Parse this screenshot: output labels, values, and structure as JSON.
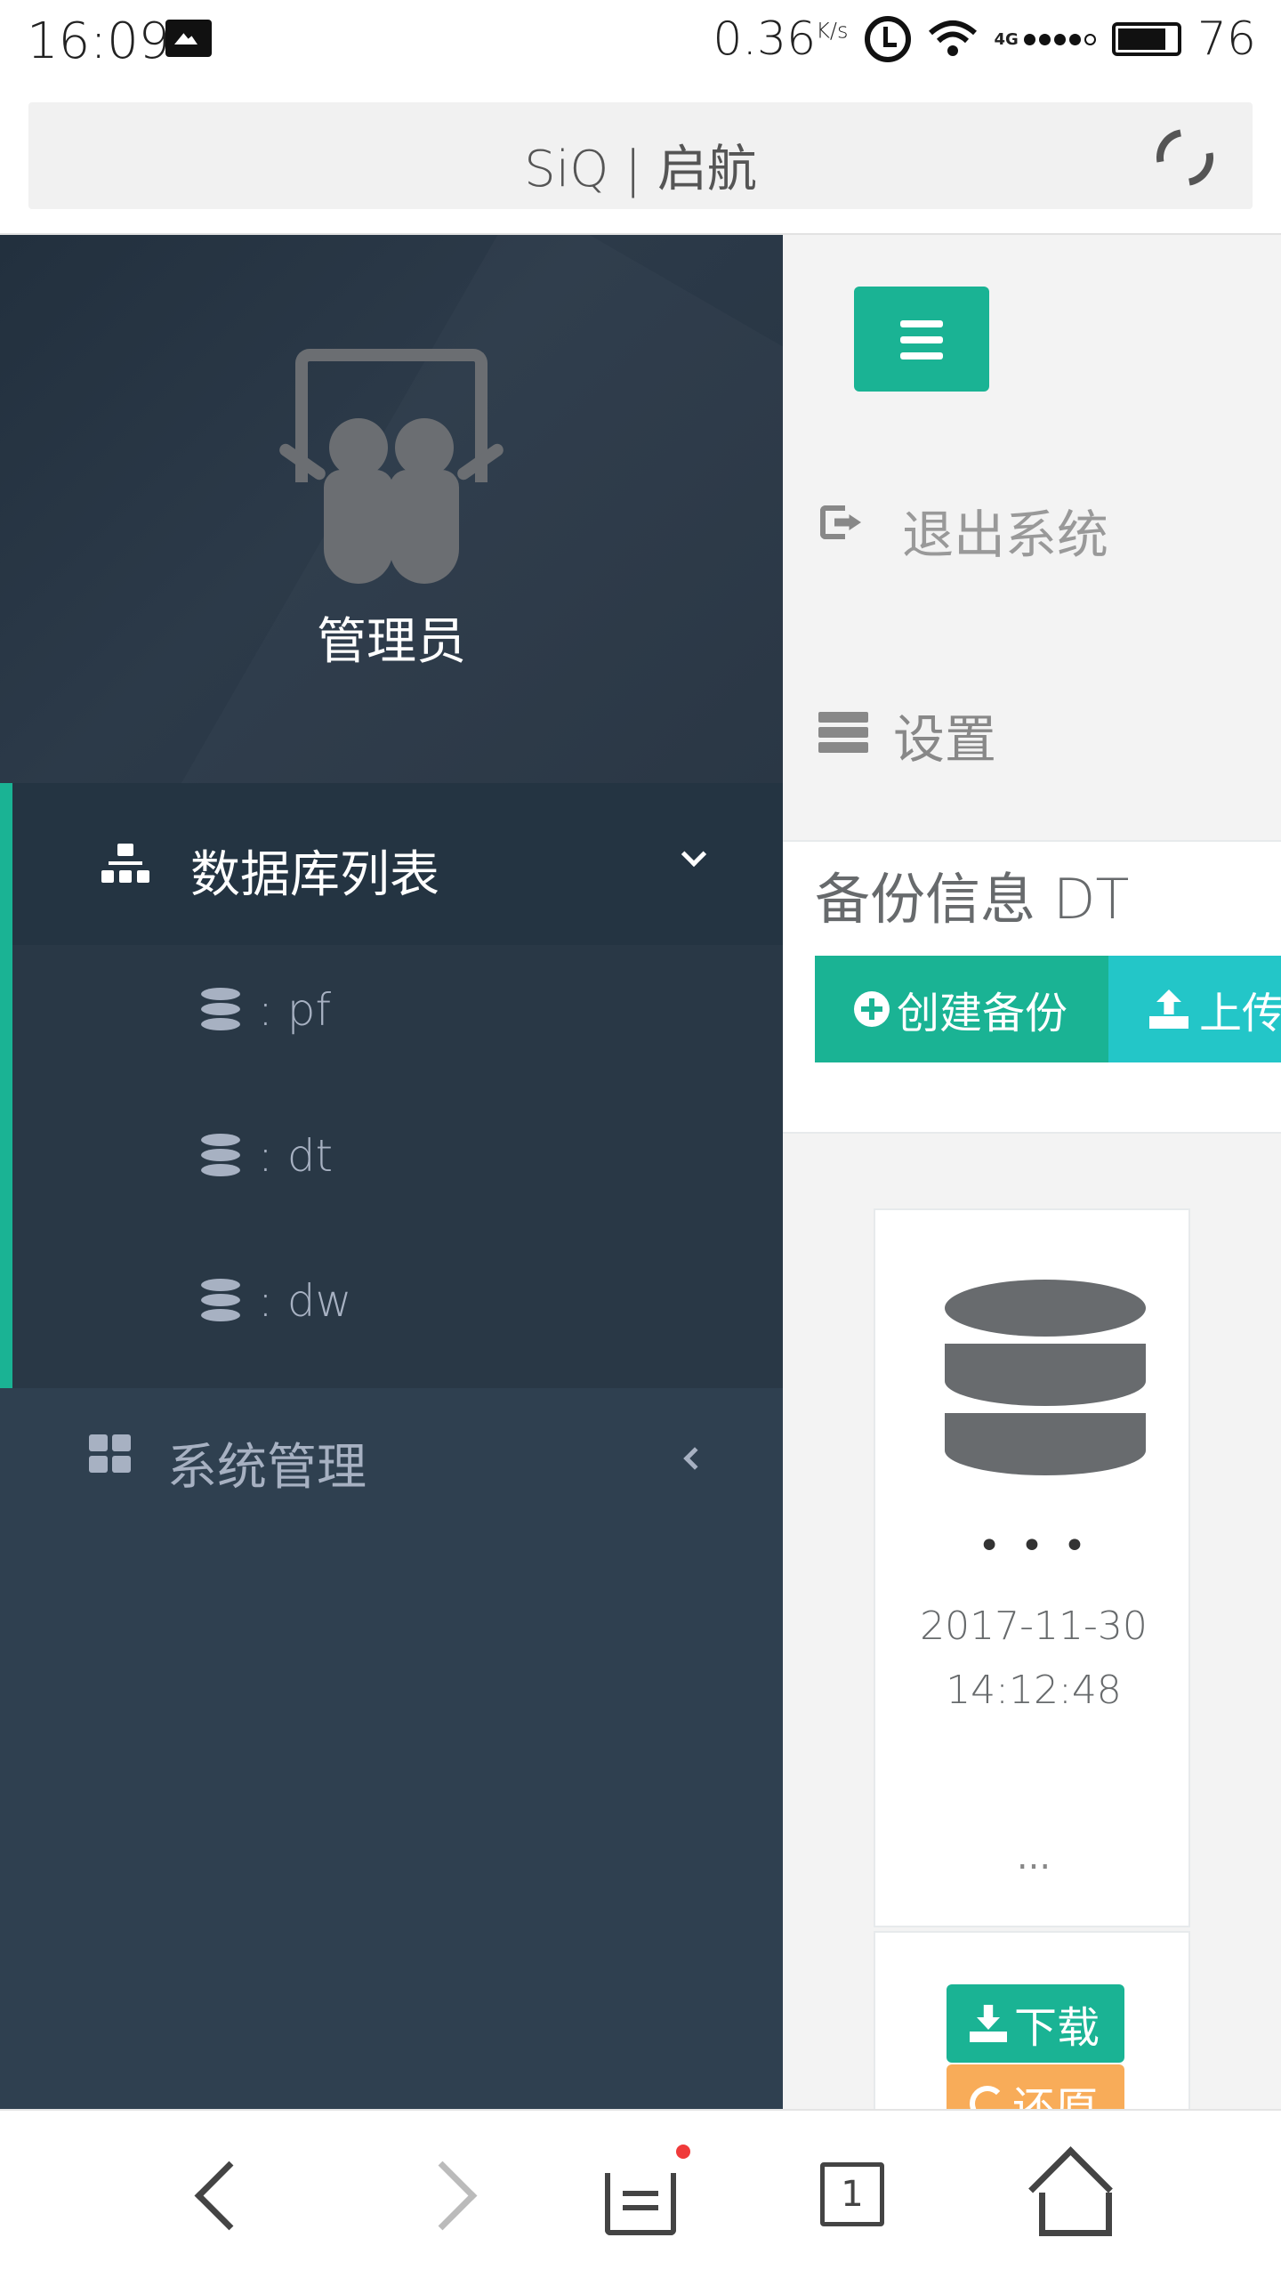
{
  "status_bar": {
    "time": "16:09",
    "speed": "0.36",
    "speed_unit": "K/s",
    "network": "4G",
    "battery": "76"
  },
  "browser": {
    "title": "SiQ | 启航",
    "tab_count": "1"
  },
  "sidebar": {
    "profile_name": "管理员",
    "db_list_label": "数据库列表",
    "databases": [
      ": pf",
      ": dt",
      ": dw"
    ],
    "system_label": "系统管理"
  },
  "content": {
    "logout_label": "退出系统",
    "settings_label": "设置",
    "backup_title": "备份信息 DT",
    "create_backup_label": "创建备份",
    "upload_label": "上传",
    "card": {
      "ellipsis_top": "• • •",
      "date": "2017-11-30 14:12:48",
      "ellipsis_bottom": "...",
      "download_label": "下载",
      "restore_label": "还原"
    }
  },
  "colors": {
    "sidebar_bg": "#2f4050",
    "primary": "#1ab394",
    "info": "#23c6c8",
    "warning": "#f8ac59"
  }
}
